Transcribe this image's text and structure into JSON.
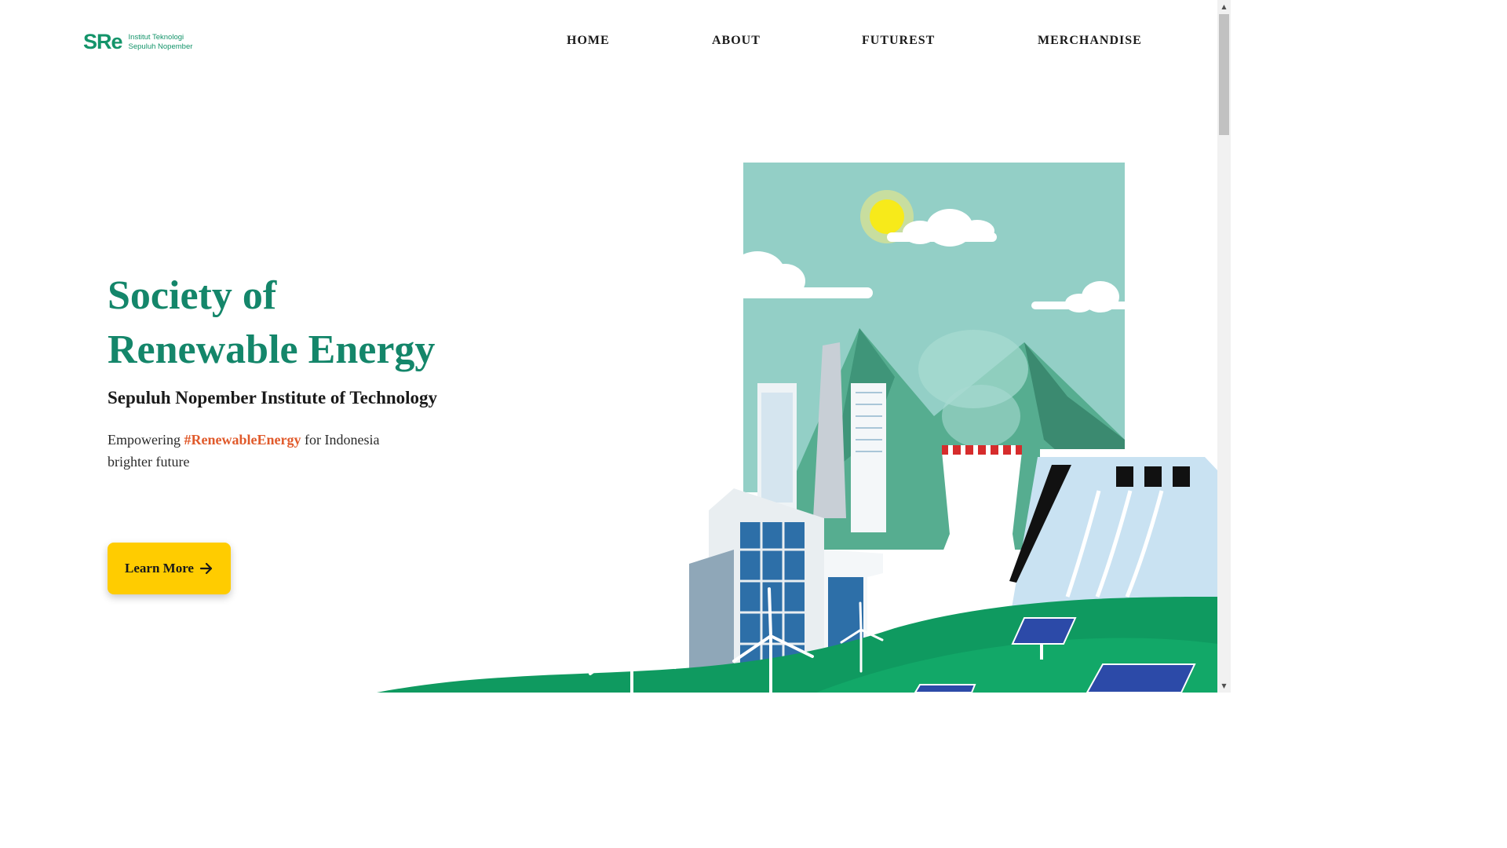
{
  "logo": {
    "mark": "SRe",
    "line1": "Institut Teknologi",
    "line2": "Sepuluh Nopember"
  },
  "nav": {
    "items": [
      {
        "label": "HOME"
      },
      {
        "label": "ABOUT"
      },
      {
        "label": "FUTUREST"
      },
      {
        "label": "MERCHANDISE"
      }
    ]
  },
  "hero": {
    "title_line1": "Society of",
    "title_line2": "Renewable Energy",
    "subtitle": "Sepuluh Nopember Institute of Technology",
    "tagline_before": "Empowering ",
    "tagline_hashtag": "#RenewableEnergy",
    "tagline_after": " for Indonesia brighter future",
    "cta_label": "Learn More",
    "cta_icon": "arrow-right-icon"
  },
  "colors": {
    "brand_green": "#14866a",
    "accent_orange": "#e05a2b",
    "cta_yellow": "#ffcc00",
    "sky": "#93cfc6",
    "hill_green": "#0f9a60"
  }
}
